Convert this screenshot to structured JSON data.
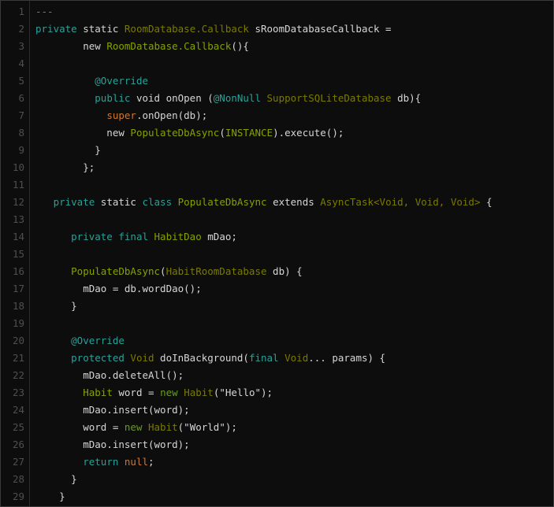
{
  "editor": {
    "name": "code-listing",
    "language": "java",
    "background_color": "#0d0d0d",
    "border_color": "#3a3a3a",
    "gutter_color": "#4f4f4f",
    "first_line_number": 1,
    "last_line_number": 29,
    "total_lines": 29
  },
  "colors": {
    "keyword": "#2aa198",
    "type": "#7a7a00",
    "identifier": "#88a000",
    "annotation": "#2aa198",
    "literal": "#cb7832",
    "new_keyword": "#6a9b23",
    "plain": "#d6d6d6",
    "line_number": "#4f4f4f"
  },
  "lines": [
    {
      "n": "1",
      "tokens": [
        {
          "t": "---",
          "c": "t-comment"
        }
      ]
    },
    {
      "n": "2",
      "tokens": [
        {
          "t": "private",
          "c": "t-kw"
        },
        {
          "t": " ",
          "c": "t-plain"
        },
        {
          "t": "static",
          "c": "t-plain"
        },
        {
          "t": " ",
          "c": "t-plain"
        },
        {
          "t": "RoomDatabase.Callback",
          "c": "t-type"
        },
        {
          "t": " sRoomDatabaseCallback =",
          "c": "t-plain"
        }
      ]
    },
    {
      "n": "3",
      "tokens": [
        {
          "t": "        new ",
          "c": "t-plain"
        },
        {
          "t": "RoomDatabase.Callback",
          "c": "t-ident"
        },
        {
          "t": "(){",
          "c": "t-plain"
        }
      ]
    },
    {
      "n": "4",
      "tokens": [
        {
          "t": "",
          "c": "t-plain"
        }
      ]
    },
    {
      "n": "5",
      "tokens": [
        {
          "t": "          ",
          "c": "t-plain"
        },
        {
          "t": "@Override",
          "c": "t-anno"
        }
      ]
    },
    {
      "n": "6",
      "tokens": [
        {
          "t": "          ",
          "c": "t-plain"
        },
        {
          "t": "public",
          "c": "t-kw"
        },
        {
          "t": " void onOpen (",
          "c": "t-plain"
        },
        {
          "t": "@NonNull",
          "c": "t-anno"
        },
        {
          "t": " ",
          "c": "t-plain"
        },
        {
          "t": "SupportSQLiteDatabase",
          "c": "t-type"
        },
        {
          "t": " db){",
          "c": "t-plain"
        }
      ]
    },
    {
      "n": "7",
      "tokens": [
        {
          "t": "            ",
          "c": "t-plain"
        },
        {
          "t": "super",
          "c": "t-lit"
        },
        {
          "t": ".onOpen(db);",
          "c": "t-plain"
        }
      ]
    },
    {
      "n": "8",
      "tokens": [
        {
          "t": "            new ",
          "c": "t-plain"
        },
        {
          "t": "PopulateDbAsync",
          "c": "t-ident"
        },
        {
          "t": "(",
          "c": "t-plain"
        },
        {
          "t": "INSTANCE",
          "c": "t-ident"
        },
        {
          "t": ").execute();",
          "c": "t-plain"
        }
      ]
    },
    {
      "n": "9",
      "tokens": [
        {
          "t": "          }",
          "c": "t-plain"
        }
      ]
    },
    {
      "n": "10",
      "tokens": [
        {
          "t": "        };",
          "c": "t-plain"
        }
      ]
    },
    {
      "n": "11",
      "tokens": [
        {
          "t": "",
          "c": "t-plain"
        }
      ]
    },
    {
      "n": "12",
      "tokens": [
        {
          "t": "   ",
          "c": "t-plain"
        },
        {
          "t": "private",
          "c": "t-kw"
        },
        {
          "t": " ",
          "c": "t-plain"
        },
        {
          "t": "static",
          "c": "t-plain"
        },
        {
          "t": " ",
          "c": "t-plain"
        },
        {
          "t": "class",
          "c": "t-kw"
        },
        {
          "t": " ",
          "c": "t-plain"
        },
        {
          "t": "PopulateDbAsync",
          "c": "t-ident"
        },
        {
          "t": " extends ",
          "c": "t-plain"
        },
        {
          "t": "AsyncTask<Void, Void, Void>",
          "c": "t-type"
        },
        {
          "t": " {",
          "c": "t-plain"
        }
      ]
    },
    {
      "n": "13",
      "tokens": [
        {
          "t": "",
          "c": "t-plain"
        }
      ]
    },
    {
      "n": "14",
      "tokens": [
        {
          "t": "      ",
          "c": "t-plain"
        },
        {
          "t": "private final",
          "c": "t-kw"
        },
        {
          "t": " ",
          "c": "t-plain"
        },
        {
          "t": "HabitDao",
          "c": "t-ident"
        },
        {
          "t": " mDao;",
          "c": "t-plain"
        }
      ]
    },
    {
      "n": "15",
      "tokens": [
        {
          "t": "",
          "c": "t-plain"
        }
      ]
    },
    {
      "n": "16",
      "tokens": [
        {
          "t": "      ",
          "c": "t-plain"
        },
        {
          "t": "PopulateDbAsync",
          "c": "t-ident"
        },
        {
          "t": "(",
          "c": "t-plain"
        },
        {
          "t": "HabitRoomDatabase",
          "c": "t-type"
        },
        {
          "t": " db) {",
          "c": "t-plain"
        }
      ]
    },
    {
      "n": "17",
      "tokens": [
        {
          "t": "        mDao = db.wordDao();",
          "c": "t-plain"
        }
      ]
    },
    {
      "n": "18",
      "tokens": [
        {
          "t": "      }",
          "c": "t-plain"
        }
      ]
    },
    {
      "n": "19",
      "tokens": [
        {
          "t": "",
          "c": "t-plain"
        }
      ]
    },
    {
      "n": "20",
      "tokens": [
        {
          "t": "      ",
          "c": "t-plain"
        },
        {
          "t": "@Override",
          "c": "t-anno"
        }
      ]
    },
    {
      "n": "21",
      "tokens": [
        {
          "t": "      ",
          "c": "t-plain"
        },
        {
          "t": "protected",
          "c": "t-kw"
        },
        {
          "t": " ",
          "c": "t-plain"
        },
        {
          "t": "Void",
          "c": "t-type"
        },
        {
          "t": " doInBackground(",
          "c": "t-plain"
        },
        {
          "t": "final",
          "c": "t-kw"
        },
        {
          "t": " ",
          "c": "t-plain"
        },
        {
          "t": "Void",
          "c": "t-type"
        },
        {
          "t": "... params) {",
          "c": "t-plain"
        }
      ]
    },
    {
      "n": "22",
      "tokens": [
        {
          "t": "        mDao.deleteAll();",
          "c": "t-plain"
        }
      ]
    },
    {
      "n": "23",
      "tokens": [
        {
          "t": "        ",
          "c": "t-plain"
        },
        {
          "t": "Habit",
          "c": "t-ident"
        },
        {
          "t": " word = ",
          "c": "t-plain"
        },
        {
          "t": "new",
          "c": "t-new"
        },
        {
          "t": " ",
          "c": "t-plain"
        },
        {
          "t": "Habit",
          "c": "t-type"
        },
        {
          "t": "(\"Hello\");",
          "c": "t-plain"
        }
      ]
    },
    {
      "n": "24",
      "tokens": [
        {
          "t": "        mDao.insert(word);",
          "c": "t-plain"
        }
      ]
    },
    {
      "n": "25",
      "tokens": [
        {
          "t": "        word = ",
          "c": "t-plain"
        },
        {
          "t": "new",
          "c": "t-new"
        },
        {
          "t": " ",
          "c": "t-plain"
        },
        {
          "t": "Habit",
          "c": "t-type"
        },
        {
          "t": "(\"World\");",
          "c": "t-plain"
        }
      ]
    },
    {
      "n": "26",
      "tokens": [
        {
          "t": "        mDao.insert(word);",
          "c": "t-plain"
        }
      ]
    },
    {
      "n": "27",
      "tokens": [
        {
          "t": "        ",
          "c": "t-plain"
        },
        {
          "t": "return",
          "c": "t-kw"
        },
        {
          "t": " ",
          "c": "t-plain"
        },
        {
          "t": "null",
          "c": "t-lit"
        },
        {
          "t": ";",
          "c": "t-plain"
        }
      ]
    },
    {
      "n": "28",
      "tokens": [
        {
          "t": "      }",
          "c": "t-plain"
        }
      ]
    },
    {
      "n": "29",
      "tokens": [
        {
          "t": "    }",
          "c": "t-plain"
        }
      ]
    }
  ]
}
